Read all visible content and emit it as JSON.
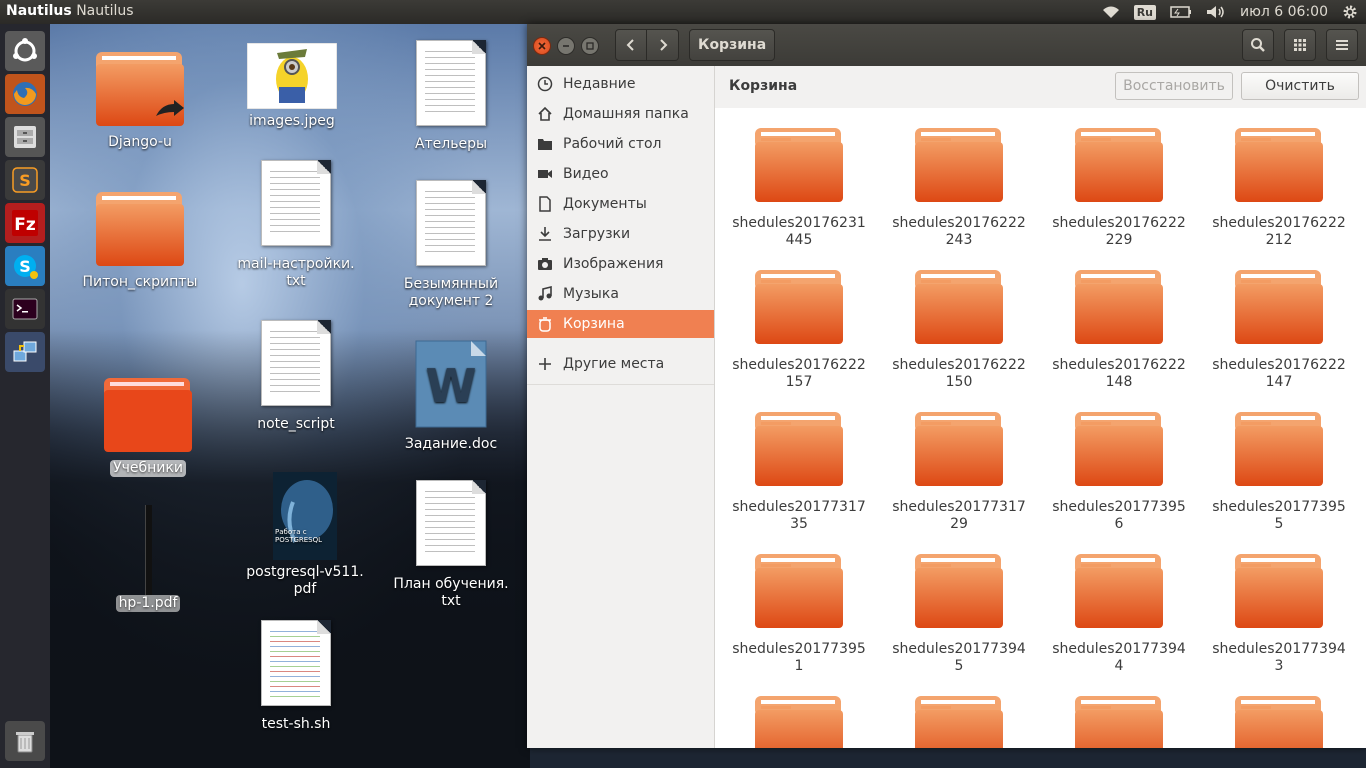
{
  "top_panel": {
    "app_name": "Nautilus",
    "window_title": "Nautilus",
    "keyboard_layout": "Ru",
    "clock": "июл  6 06:00"
  },
  "launcher": {
    "items": [
      "ubuntu-dash-icon",
      "firefox-icon",
      "files-icon",
      "sublime-text-icon",
      "filezilla-icon",
      "skype-icon",
      "terminal-icon",
      "network-settings-icon",
      "trash-icon"
    ]
  },
  "desktop": {
    "icons": [
      {
        "label": "Django-u",
        "type": "folder-link"
      },
      {
        "label": "images.jpeg",
        "type": "image"
      },
      {
        "label": "Ательеры",
        "type": "text"
      },
      {
        "label": "mail-настройки.\ntxt",
        "type": "text"
      },
      {
        "label": "Питон_скрипты",
        "type": "folder"
      },
      {
        "label": "Безымянный\nдокумент 2",
        "type": "text"
      },
      {
        "label": "note_script",
        "type": "text"
      },
      {
        "label": "Учебники",
        "type": "folder"
      },
      {
        "label": "Задание.doc",
        "type": "word"
      },
      {
        "label": "postgresql-v511.\npdf",
        "type": "pdf"
      },
      {
        "label": "hp-1.pdf",
        "type": "pdf"
      },
      {
        "label": "План обучения.\ntxt",
        "type": "text"
      },
      {
        "label": "test-sh.sh",
        "type": "script"
      }
    ],
    "pdf_cover_text": "Работа с\nPOSTGRESQL"
  },
  "window": {
    "location": "Корзина",
    "sidebar": [
      {
        "label": "Недавние",
        "icon": "clock-icon"
      },
      {
        "label": "Домашняя папка",
        "icon": "home-icon"
      },
      {
        "label": "Рабочий стол",
        "icon": "desktop-folder-icon"
      },
      {
        "label": "Видео",
        "icon": "video-icon"
      },
      {
        "label": "Документы",
        "icon": "document-icon"
      },
      {
        "label": "Загрузки",
        "icon": "download-icon"
      },
      {
        "label": "Изображения",
        "icon": "camera-icon"
      },
      {
        "label": "Музыка",
        "icon": "music-icon"
      },
      {
        "label": "Корзина",
        "icon": "trash-icon",
        "active": true
      },
      {
        "label": "Другие места",
        "icon": "plus-icon"
      }
    ],
    "content_title": "Корзина",
    "restore_label": "Восстановить",
    "empty_label": "Очистить",
    "files": [
      "shedules20176231\n445",
      "shedules20176222\n243",
      "shedules20176222\n229",
      "shedules20176222\n212",
      "shedules20176222\n157",
      "shedules20176222\n150",
      "shedules20176222\n148",
      "shedules20176222\n147",
      "shedules20177317\n35",
      "shedules20177317\n29",
      "shedules20177395\n6",
      "shedules20177395\n5",
      "shedules20177395\n1",
      "shedules20177394\n5",
      "shedules20177394\n4",
      "shedules20177394\n3",
      "",
      "",
      "",
      ""
    ]
  },
  "colors": {
    "accent": "#f08051",
    "folder_top": "#f39c63",
    "folder_bottom": "#dd4814",
    "panel": "#3c3b37"
  }
}
